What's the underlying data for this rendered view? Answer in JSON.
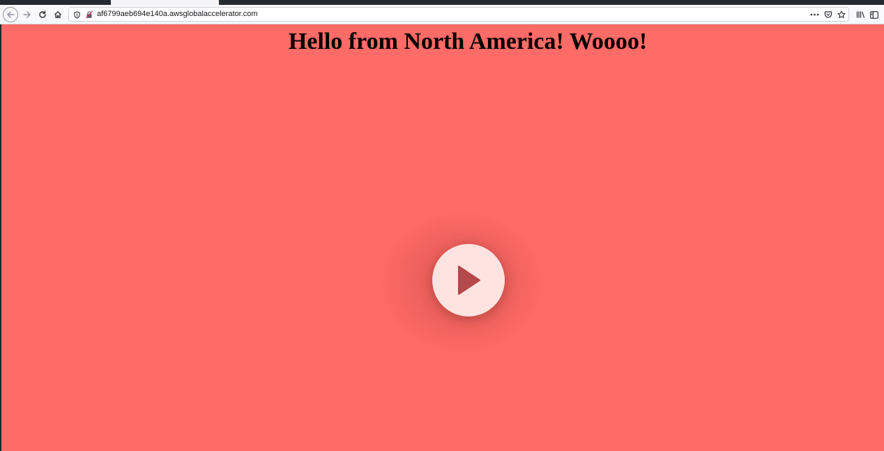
{
  "browser": {
    "url": "af6799aeb694e140a.awsglobalaccelerator.com",
    "toolbar_icons": [
      "back-icon",
      "forward-icon",
      "reload-icon",
      "home-icon",
      "shield-icon",
      "insecure-lock-icon",
      "more-icon",
      "pocket-icon",
      "star-icon",
      "library-icon",
      "sidebar-icon"
    ]
  },
  "page": {
    "heading": "Hello from North America! Woooo!",
    "background_color": "#ff6b66",
    "play_button": {
      "icon": "play-icon",
      "fill_color": "#ffe3e0",
      "icon_color": "#b5484a"
    }
  }
}
